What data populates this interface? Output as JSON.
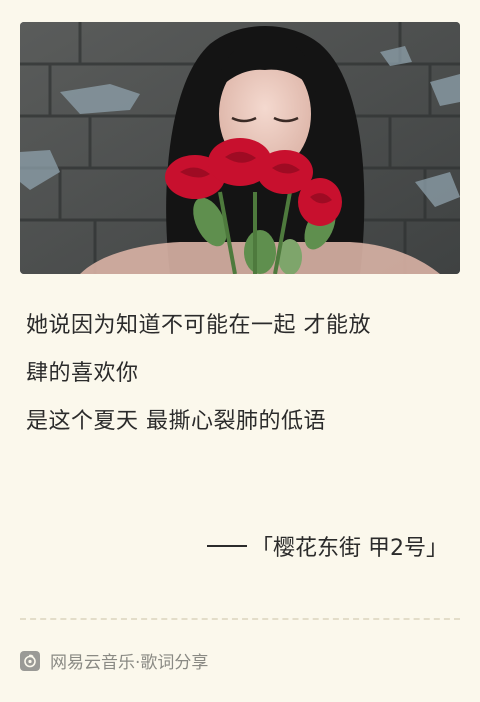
{
  "photo": {
    "icon": "woman-with-red-roses-photo"
  },
  "lyrics": {
    "lines": [
      "她说因为知道不可能在一起 才能放",
      "肆的喜欢你",
      "是这个夏天 最撕心裂肺的低语"
    ]
  },
  "attribution": {
    "text": "「樱花东街 甲2号」"
  },
  "footer": {
    "logo_icon": "netease-music-icon",
    "label": "网易云音乐·歌词分享"
  },
  "colors": {
    "background": "#fbf8ec",
    "text": "#2b2b2b",
    "footer_text": "#8a8a84",
    "rose": "#c8102e"
  }
}
